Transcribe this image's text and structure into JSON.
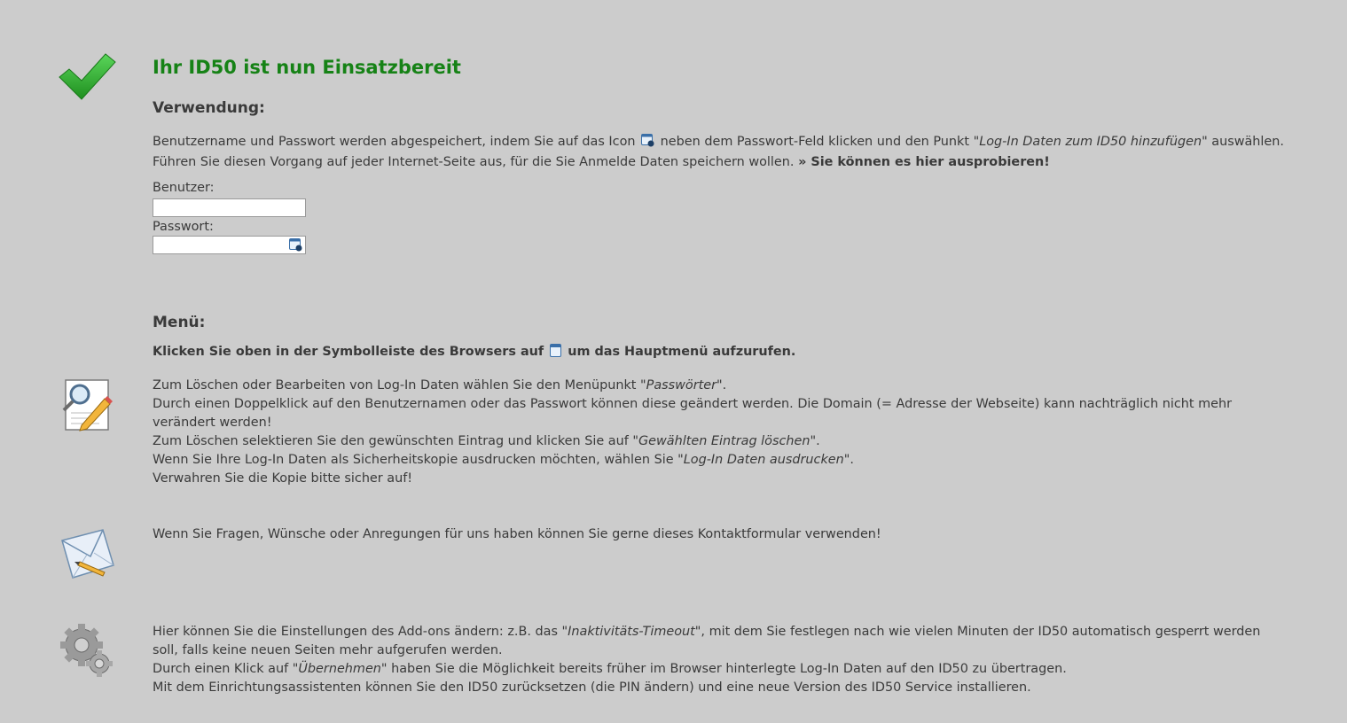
{
  "header": {
    "title": "Ihr ID50 ist nun Einsatzbereit"
  },
  "usage": {
    "heading": "Verwendung:",
    "line1_before_icon": "Benutzername und Passwort werden abgespeichert, indem Sie auf das Icon",
    "line1_after_icon": "neben dem Passwort-Feld klicken und den Punkt \"",
    "line1_italic": "Log-In Daten zum ID50 hinzufügen",
    "line1_end": "\" auswählen.",
    "line2_text": "Führen Sie diesen Vorgang auf jeder Internet-Seite aus, für die Sie Anmelde Daten speichern wollen.",
    "line2_bold": "» Sie können es hier ausprobieren!",
    "user_label": "Benutzer:",
    "user_value": "",
    "password_label": "Passwort:",
    "password_value": ""
  },
  "menu": {
    "heading": "Menü:",
    "instruction_before": "Klicken Sie oben in der Symbolleiste des Browsers auf",
    "instruction_after": "um das Hauptmenü aufzurufen."
  },
  "passwords_section": {
    "l1_a": "Zum Löschen oder Bearbeiten von Log-In Daten wählen Sie den Menüpunkt \"",
    "l1_i": "Passwörter",
    "l1_b": "\".",
    "l2": "Durch einen Doppelklick auf den Benutzernamen oder das Passwort können diese geändert werden. Die Domain (= Adresse der Webseite) kann nachträglich nicht mehr verändert werden!",
    "l3_a": "Zum Löschen selektieren Sie den gewünschten Eintrag und klicken Sie auf \"",
    "l3_i": "Gewählten Eintrag löschen",
    "l3_b": "\".",
    "l4_a": "Wenn Sie Ihre Log-In Daten als Sicherheitskopie ausdrucken möchten, wählen Sie \"",
    "l4_i": "Log-In Daten ausdrucken",
    "l4_b": "\".",
    "l5": "Verwahren Sie die Kopie bitte sicher auf!"
  },
  "contact_section": {
    "text": "Wenn Sie Fragen, Wünsche oder Anregungen für uns haben können Sie gerne dieses Kontaktformular verwenden!"
  },
  "settings_section": {
    "l1_a": "Hier können Sie die Einstellungen des Add-ons ändern: z.B. das \"",
    "l1_i": "Inaktivitäts-Timeout",
    "l1_b": "\", mit dem Sie festlegen nach wie vielen Minuten der ID50 automatisch gesperrt werden soll, falls keine neuen Seiten mehr aufgerufen werden.",
    "l2_a": "Durch einen Klick auf \"",
    "l2_i": "Übernehmen",
    "l2_b": "\" haben Sie die Möglichkeit bereits früher im Browser hinterlegte Log-In Daten auf den ID50 zu übertragen.",
    "l3": "Mit dem Einrichtungsassistenten können Sie den ID50 zurücksetzen (die PIN ändern) und eine neue Version des ID50 Service installieren."
  },
  "icons": {
    "success": "checkmark-icon",
    "id50_field": "id50-key-icon",
    "toolbar": "id50-toolbar-icon",
    "passwords": "document-search-edit-icon",
    "contact": "mail-envelope-icon",
    "settings": "gears-icon"
  },
  "colors": {
    "background": "#cccccc",
    "title": "#168216",
    "text": "#3a3a3a",
    "check": "#2ea82e"
  }
}
